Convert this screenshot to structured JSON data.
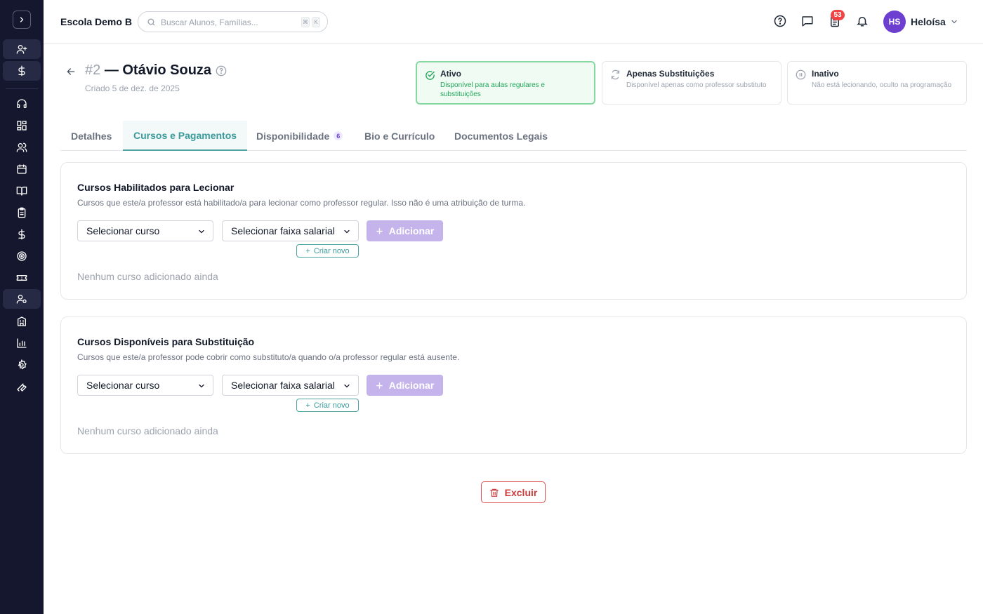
{
  "header": {
    "school_name": "Escola Demo B",
    "search_placeholder": "Buscar Alunos, Famílias...",
    "kbd_mod": "⌘",
    "kbd_key": "K",
    "tasks_badge": "53",
    "user_initials": "HS",
    "user_name": "Heloísa"
  },
  "sidebar": {
    "items": [
      {
        "icon": "user-plus-icon"
      },
      {
        "icon": "dollar-icon"
      },
      {
        "icon": "headset-icon"
      },
      {
        "icon": "dashboard-icon"
      },
      {
        "icon": "users-icon"
      },
      {
        "icon": "calendar-icon"
      },
      {
        "icon": "book-open-icon"
      },
      {
        "icon": "clipboard-icon"
      },
      {
        "icon": "dollar-icon"
      },
      {
        "icon": "target-icon"
      },
      {
        "icon": "ticket-icon"
      },
      {
        "icon": "user-cog-icon"
      },
      {
        "icon": "building-icon"
      },
      {
        "icon": "bar-chart-icon"
      },
      {
        "icon": "gear-icon"
      },
      {
        "icon": "wrench-icon"
      }
    ]
  },
  "teacher": {
    "number": "#2",
    "name": "— Otávio Souza",
    "created": "Criado 5 de dez. de 2025"
  },
  "status_options": [
    {
      "title": "Ativo",
      "desc": "Disponível para aulas regulares e substituições",
      "selected": true
    },
    {
      "title": "Apenas Substituições",
      "desc": "Disponível apenas como professor substituto",
      "selected": false
    },
    {
      "title": "Inativo",
      "desc": "Não está lecionando, oculto na programação",
      "selected": false
    }
  ],
  "tabs": [
    {
      "label": "Detalhes"
    },
    {
      "label": "Cursos e Pagamentos"
    },
    {
      "label": "Disponibilidade",
      "count": "6"
    },
    {
      "label": "Bio e Currículo"
    },
    {
      "label": "Documentos Legais"
    }
  ],
  "sections": [
    {
      "title": "Cursos Habilitados para Lecionar",
      "desc": "Cursos que este/a professor está habilitado/a para lecionar como professor regular. Isso não é uma atribuição de turma.",
      "course_select": "Selecionar curso",
      "salary_select": "Selecionar faixa salarial",
      "add_label": "Adicionar",
      "new_label": "Criar novo",
      "empty": "Nenhum curso adicionado ainda"
    },
    {
      "title": "Cursos Disponíveis para Substituição",
      "desc": "Cursos que este/a professor pode cobrir como substituto/a quando o/a professor regular está ausente.",
      "course_select": "Selecionar curso",
      "salary_select": "Selecionar faixa salarial",
      "add_label": "Adicionar",
      "new_label": "Criar novo",
      "empty": "Nenhum curso adicionado ainda"
    }
  ],
  "actions": {
    "delete_label": "Excluir"
  }
}
